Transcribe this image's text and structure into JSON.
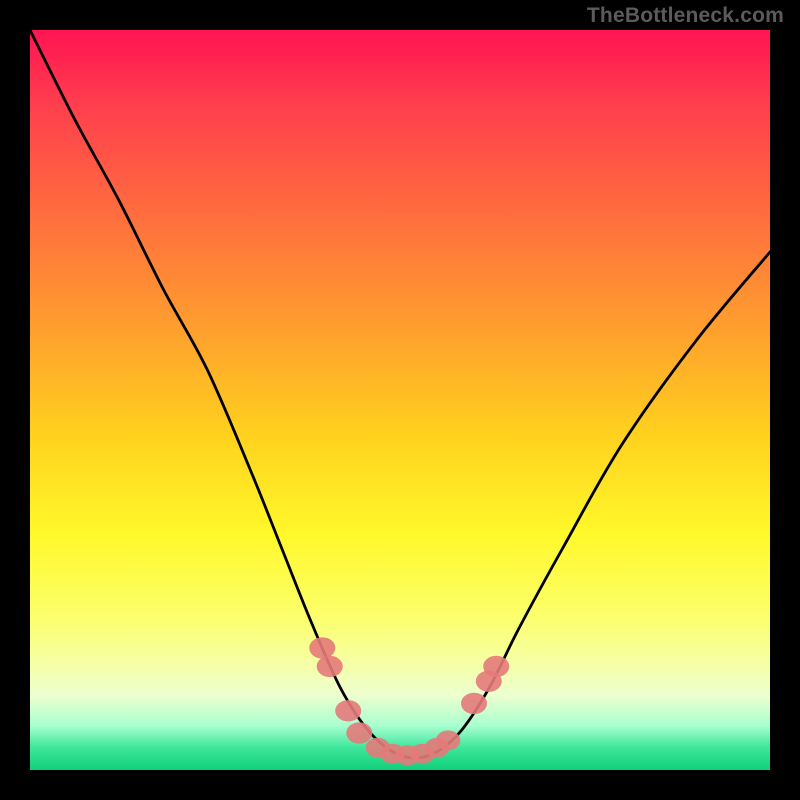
{
  "watermark": "TheBottleneck.com",
  "watermark_font_size_px": 21,
  "colors": {
    "frame": "#000000",
    "gradient_top": "#ff1452",
    "gradient_bottom": "#10d07b",
    "curve": "#000000",
    "beads": "#e47a7a"
  },
  "chart_data": {
    "type": "line",
    "title": "",
    "xlabel": "",
    "ylabel": "",
    "xlim": [
      0,
      100
    ],
    "ylim": [
      0,
      100
    ],
    "series": [
      {
        "name": "bottleneck-curve",
        "x": [
          0,
          6,
          12,
          18,
          24,
          30,
          34,
          38,
          42,
          46,
          50,
          54,
          58,
          62,
          66,
          72,
          80,
          90,
          100
        ],
        "y": [
          100,
          88,
          77,
          65,
          54,
          40,
          30,
          20,
          11,
          5,
          2,
          2,
          5,
          11,
          19,
          30,
          44,
          58,
          70
        ]
      }
    ],
    "annotations": {
      "trough_x_range": [
        44,
        58
      ],
      "trough_y": 2
    },
    "bead_markers": [
      {
        "x": 39.5,
        "y": 16.5,
        "r": 1.6
      },
      {
        "x": 40.5,
        "y": 14.0,
        "r": 1.6
      },
      {
        "x": 43.0,
        "y": 8.0,
        "r": 1.6
      },
      {
        "x": 44.5,
        "y": 5.0,
        "r": 1.6
      },
      {
        "x": 47.0,
        "y": 3.0,
        "r": 1.5
      },
      {
        "x": 49.0,
        "y": 2.2,
        "r": 1.5
      },
      {
        "x": 51.0,
        "y": 2.0,
        "r": 1.5
      },
      {
        "x": 53.0,
        "y": 2.2,
        "r": 1.5
      },
      {
        "x": 55.0,
        "y": 3.0,
        "r": 1.5
      },
      {
        "x": 56.5,
        "y": 4.0,
        "r": 1.5
      },
      {
        "x": 60.0,
        "y": 9.0,
        "r": 1.6
      },
      {
        "x": 62.0,
        "y": 12.0,
        "r": 1.6
      },
      {
        "x": 63.0,
        "y": 14.0,
        "r": 1.6
      }
    ]
  }
}
